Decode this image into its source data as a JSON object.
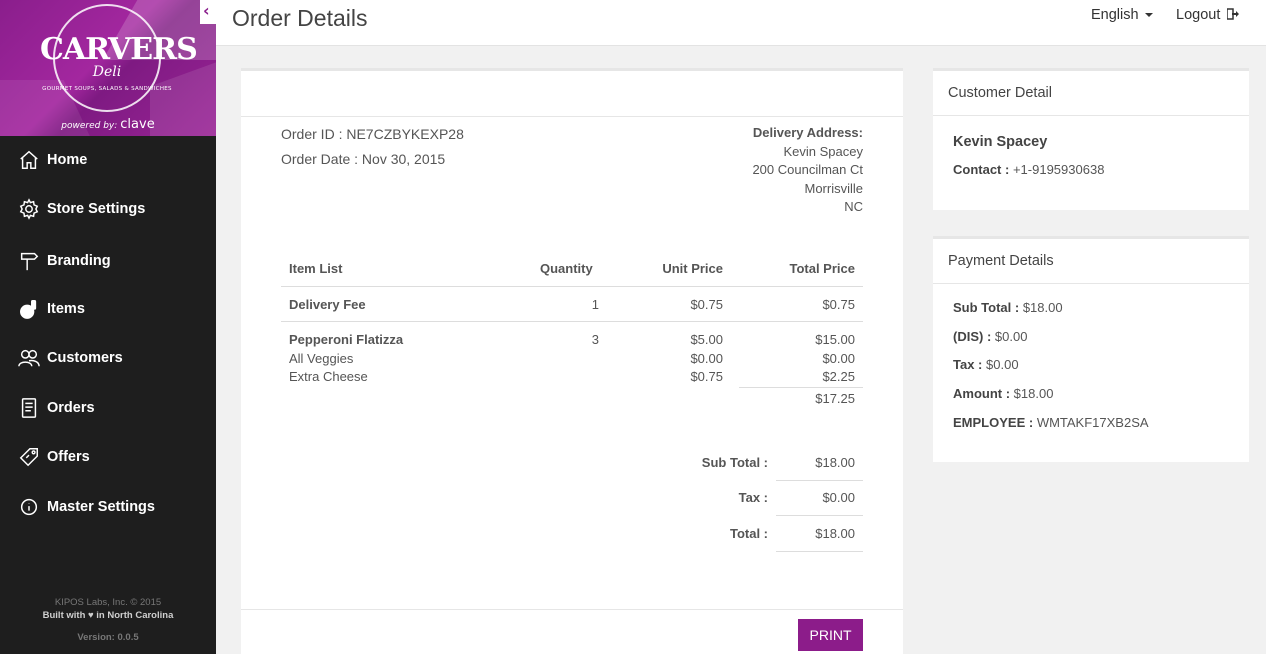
{
  "brand": {
    "name": "CARVERS",
    "sub": "Deli",
    "tagline": "GOURMET SOUPS, SALADS & SANDWICHES",
    "powered_prefix": "powered by:",
    "powered_brand": "clave",
    "colors": {
      "primary": "#8c1c8a",
      "sidebar": "#1e1e1e"
    }
  },
  "nav": [
    {
      "label": "Home",
      "icon": "home-icon"
    },
    {
      "label": "Store Settings",
      "icon": "gear-icon"
    },
    {
      "label": "Branding",
      "icon": "signpost-icon"
    },
    {
      "label": "Items",
      "icon": "food-icon"
    },
    {
      "label": "Customers",
      "icon": "users-icon"
    },
    {
      "label": "Orders",
      "icon": "receipt-icon"
    },
    {
      "label": "Offers",
      "icon": "tag-icon"
    },
    {
      "label": "Master Settings",
      "icon": "info-icon"
    }
  ],
  "footer": {
    "copyright": "KIPOS Labs, Inc. © 2015",
    "built_prefix": "Built with",
    "built_suffix": "in North Carolina",
    "version": "Version: 0.0.5"
  },
  "header": {
    "title": "Order Details",
    "language": "English",
    "logout": "Logout"
  },
  "order": {
    "id_label": "Order ID :",
    "id": "NE7CZBYKEXP28",
    "date_label": "Order Date :",
    "date": "Nov 30, 2015",
    "delivery_label": "Delivery Address:",
    "address": [
      "Kevin  Spacey",
      "200 Councilman Ct",
      "Morrisville",
      "NC"
    ]
  },
  "items_table": {
    "headers": [
      "Item List",
      "Quantity",
      "Unit Price",
      "Total Price"
    ],
    "delivery": {
      "name": "Delivery Fee",
      "qty": "1",
      "unit": "$0.75",
      "total": "$0.75"
    },
    "item": {
      "name": "Pepperoni Flatizza",
      "qty": "3",
      "unit": "$5.00",
      "total": "$15.00"
    },
    "modifiers": [
      {
        "name": "All Veggies",
        "unit": "$0.00",
        "total": "$0.00"
      },
      {
        "name": "Extra Cheese",
        "unit": "$0.75",
        "total": "$2.25"
      }
    ],
    "item_total": "$17.25"
  },
  "totals": {
    "subtotal_label": "Sub Total :",
    "subtotal": "$18.00",
    "tax_label": "Tax :",
    "tax": "$0.00",
    "total_label": "Total :",
    "total": "$18.00"
  },
  "print_label": "PRINT",
  "customer_card": {
    "title": "Customer Detail",
    "name": "Kevin  Spacey",
    "contact_label": "Contact :",
    "contact": "+1-9195930638"
  },
  "payment_card": {
    "title": "Payment Details",
    "rows": [
      {
        "label": "Sub Total :",
        "value": "$18.00"
      },
      {
        "label": "(DIS) :",
        "value": "$0.00"
      },
      {
        "label": "Tax :",
        "value": "$0.00"
      },
      {
        "label": "Amount :",
        "value": "$18.00"
      },
      {
        "label": "EMPLOYEE :",
        "value": "WMTAKF17XB2SA"
      }
    ]
  }
}
